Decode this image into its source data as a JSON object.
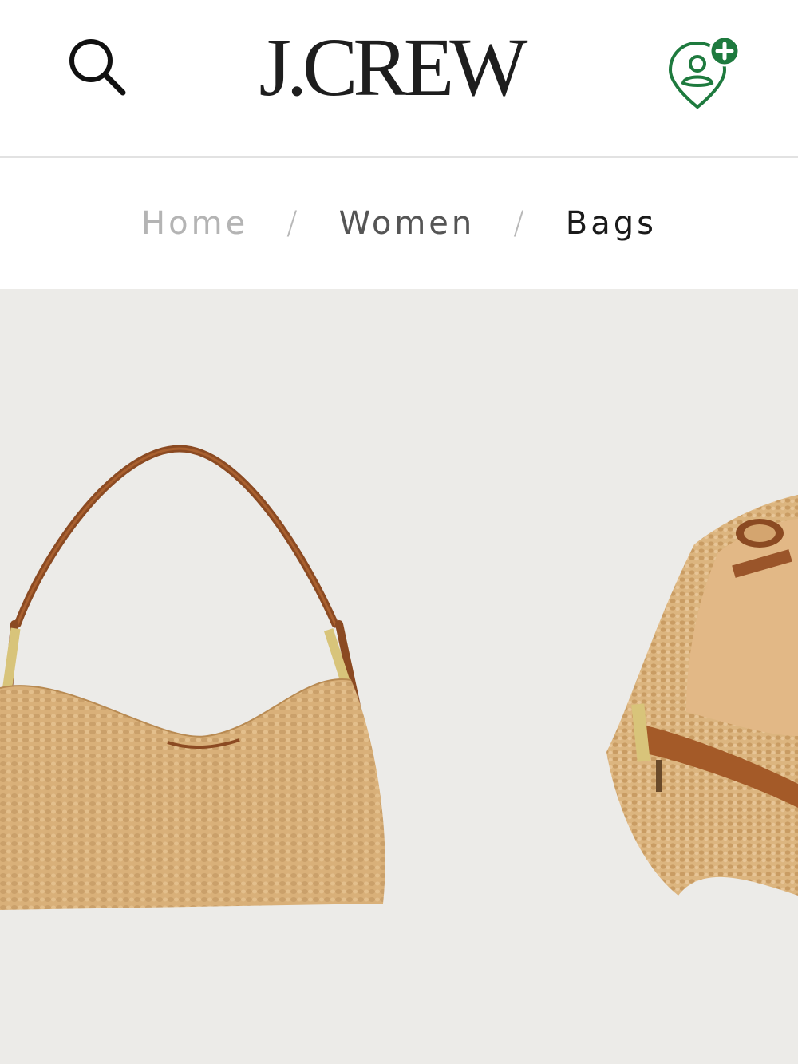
{
  "brand": {
    "logo_text": "J.CREW"
  },
  "header": {
    "search_icon": "search-icon",
    "account_icon": "add-user-location-icon"
  },
  "breadcrumb": {
    "items": [
      {
        "label": "Home"
      },
      {
        "label": "Women"
      },
      {
        "label": "Bags"
      }
    ],
    "separator": "/"
  },
  "gallery": {
    "background_color": "#ecebe8",
    "images": [
      {
        "subject": "straw shoulder bag with brown leather strap",
        "position": "front"
      },
      {
        "subject": "straw shoulder bag interior view",
        "position": "side"
      }
    ]
  },
  "colors": {
    "accent_green": "#1e7a3e",
    "text_dark": "#1e1e1e",
    "straw": "#d9b079",
    "leather": "#8b4a22"
  }
}
